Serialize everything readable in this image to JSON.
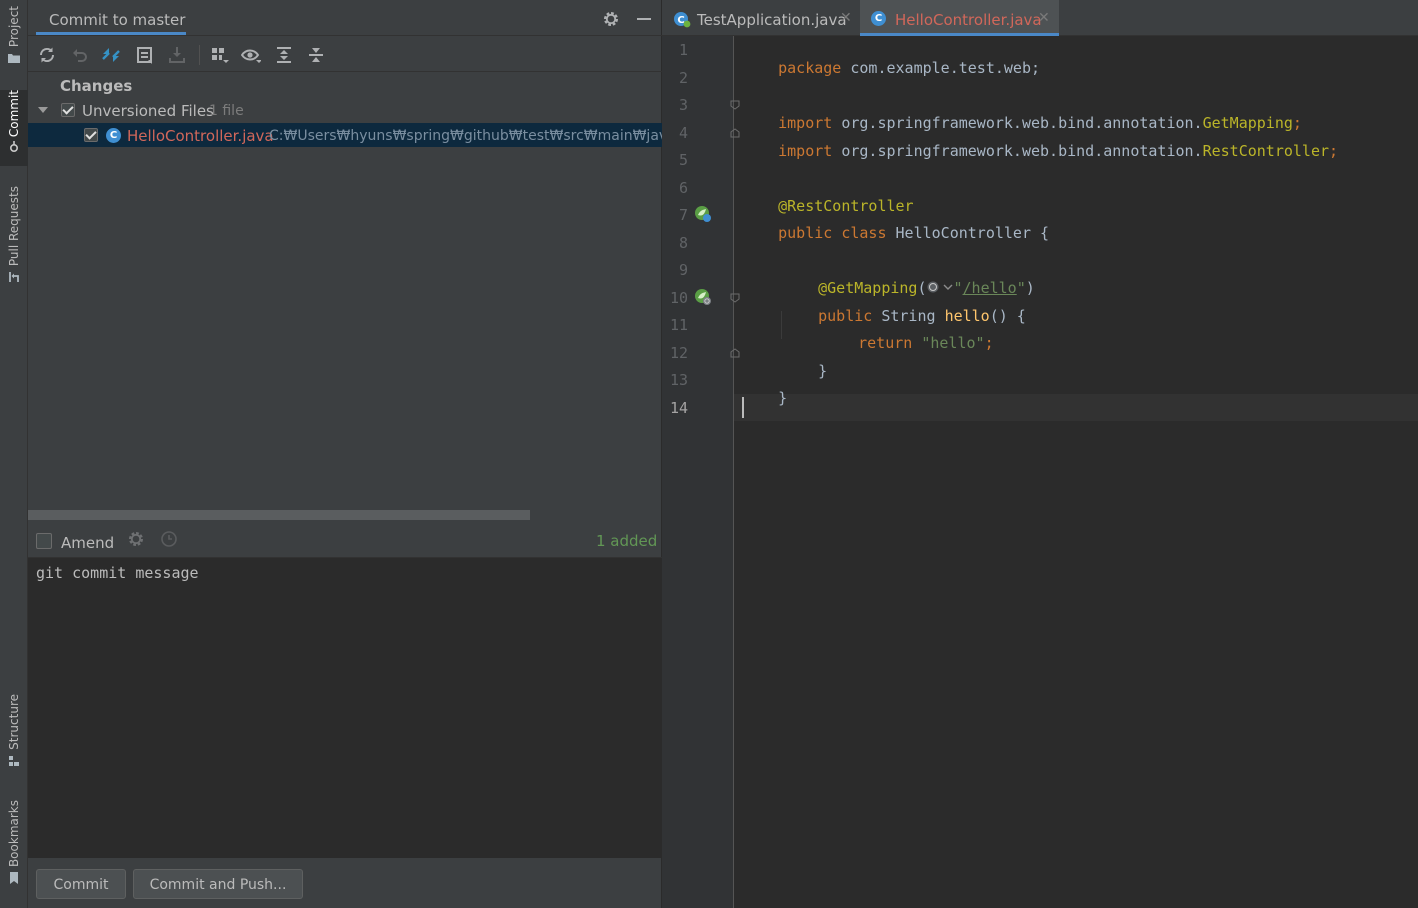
{
  "stripe": {
    "project_label": "Project",
    "commit_label": "Commit",
    "pull_requests_label": "Pull Requests",
    "structure_label": "Structure",
    "bookmarks_label": "Bookmarks"
  },
  "commit_panel": {
    "title": "Commit to master",
    "changes_label": "Changes",
    "unversioned_label": "Unversioned Files",
    "unversioned_count": "1 file",
    "file_name": "HelloController.java",
    "file_path": "C:₩Users₩hyuns₩spring₩github₩test₩src₩main₩java₩co",
    "amend_label": "Amend",
    "added_count": "1 added",
    "commit_message": "git commit message",
    "commit_button": "Commit",
    "commit_push_button": "Commit and Push..."
  },
  "editor": {
    "tabs": [
      {
        "label": "TestApplication.java",
        "close": "✕"
      },
      {
        "label": "HelloController.java",
        "close": "✕"
      }
    ],
    "line_numbers": [
      "1",
      "2",
      "3",
      "4",
      "5",
      "6",
      "7",
      "8",
      "9",
      "10",
      "11",
      "12",
      "13",
      "14"
    ],
    "code": {
      "l1_kw": "package",
      "l1_rest": " com.example.test.web;",
      "l3_kw": "import",
      "l3_rest": " org.springframework.web.bind.annotation.",
      "l3_cls": "GetMapping",
      "l3_end": ";",
      "l4_kw": "import",
      "l4_rest": " org.springframework.web.bind.annotation.",
      "l4_cls": "RestController",
      "l4_end": ";",
      "l6_ann": "@RestController",
      "l7_kw": "public class",
      "l7_rest": " HelloController {",
      "l9_ann": "@GetMapping",
      "l9_open": "(",
      "l9_q1": "\"",
      "l9_url": "/hello",
      "l9_q2": "\"",
      "l9_close": ")",
      "l10_kw": "public",
      "l10_type": " String ",
      "l10_fn": "hello",
      "l10_rest": "() {",
      "l11_kw": "return",
      "l11_str": " \"hello\"",
      "l11_end": ";",
      "l12": "}",
      "l13": "}"
    }
  },
  "colors": {
    "accent": "#4a88c7",
    "keyword": "#cc7832",
    "annotation": "#bbb529",
    "string": "#6a8759",
    "unversioned_file": "#d1675a",
    "added": "#629755"
  }
}
